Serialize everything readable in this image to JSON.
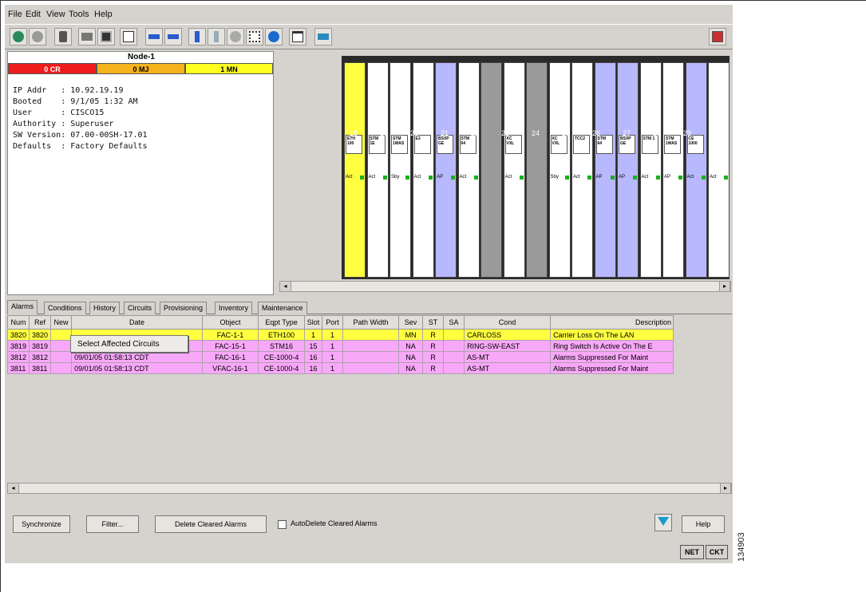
{
  "menu": [
    "File",
    "Edit",
    "View",
    "Tools",
    "Help"
  ],
  "toolbar_icons": [
    "globe-icon",
    "stop-icon",
    "lock-icon",
    "print-icon",
    "save-icon",
    "copy-icon",
    "back-arrow-icon",
    "forward-arrow-icon",
    "up-icon",
    "down-icon",
    "node-icon",
    "network-icon",
    "globe2-icon",
    "window-icon",
    "ring-icon",
    "help-book-icon"
  ],
  "node": {
    "name": "Node-1",
    "alarms": {
      "critical": "0 CR",
      "major": "0 MJ",
      "minor": "1 MN"
    },
    "info": [
      "IP Addr   : 10.92.19.19",
      "Booted    : 9/1/05 1:32 AM",
      "User      : CISCO15",
      "Authority : Superuser",
      "SW Version: 07.00-00SH-17.01",
      "Defaults  : Factory Defaults"
    ]
  },
  "slots": [
    {
      "num": "18",
      "label": "ETH 100",
      "led": "Act",
      "color": "#ffff40"
    },
    {
      "num": "19",
      "label": "STM 1E",
      "led": "Act",
      "color": "#ffffff"
    },
    {
      "num": "20",
      "label": "STM 1WAS",
      "led": "Sby",
      "color": "#ffffff"
    },
    {
      "num": "21",
      "label": "E3",
      "led": "Act",
      "color": "#ffffff"
    },
    {
      "num": "22",
      "label": "BSXP GE",
      "led": "AP",
      "color": "#b8b8ff"
    },
    {
      "num": "23",
      "label": "STM 64",
      "led": "Act",
      "color": "#ffffff"
    },
    {
      "num": "24",
      "label": "",
      "led": "",
      "color": "#9a9a9a"
    },
    {
      "num": "25",
      "label": "XC VXL",
      "led": "Act",
      "color": "#ffffff"
    },
    {
      "num": "26",
      "label": "",
      "led": "",
      "color": "#9a9a9a"
    },
    {
      "num": "27",
      "label": "XC VXL",
      "led": "Sby",
      "color": "#ffffff"
    },
    {
      "num": "28",
      "label": "TCC2",
      "led": "Act",
      "color": "#ffffff"
    },
    {
      "num": "29",
      "label": "STM 64",
      "led": "AP",
      "color": "#b8b8ff"
    },
    {
      "num": "",
      "label": "BSXP GE",
      "led": "AP",
      "color": "#b8b8ff"
    },
    {
      "num": "",
      "label": "STM 1",
      "led": "Act",
      "color": "#ffffff"
    },
    {
      "num": "",
      "label": "STM 1WAS",
      "led": "AP",
      "color": "#ffffff"
    },
    {
      "num": "",
      "label": "CE 1000",
      "led": "Act",
      "color": "#b8b8ff"
    },
    {
      "num": "",
      "label": "",
      "led": "Act",
      "color": "#ffffff"
    }
  ],
  "slot_numbers": [
    "18",
    "19",
    "20",
    "21",
    "22",
    "23",
    "24",
    "25",
    "26",
    "27",
    "28",
    "29"
  ],
  "tabs": [
    "Alarms",
    "Conditions",
    "History",
    "Circuits",
    "Provisioning",
    "Inventory",
    "Maintenance"
  ],
  "columns": [
    "Num",
    "Ref",
    "New",
    "Date",
    "Object",
    "Eqpt Type",
    "Slot",
    "Port",
    "Path Width",
    "Sev",
    "ST",
    "SA",
    "Cond",
    "Description"
  ],
  "rows": [
    {
      "num": "3820",
      "ref": "3820",
      "new": "",
      "date": "",
      "object": "FAC-1-1",
      "eqpt": "ETH100",
      "slot": "1",
      "port": "1",
      "path": "",
      "sev": "MN",
      "st": "R",
      "sa": "",
      "cond": "CARLOSS",
      "desc": "Carrier Loss On The LAN",
      "color": "yellow"
    },
    {
      "num": "3819",
      "ref": "3819",
      "new": "",
      "date": "",
      "object": "FAC-15-1",
      "eqpt": "STM16",
      "slot": "15",
      "port": "1",
      "path": "",
      "sev": "NA",
      "st": "R",
      "sa": "",
      "cond": "RING-SW-EAST",
      "desc": "Ring Switch Is Active On The E",
      "color": "pink"
    },
    {
      "num": "3812",
      "ref": "3812",
      "new": "",
      "date": "09/01/05 01:58:13 CDT",
      "object": "FAC-16-1",
      "eqpt": "CE-1000-4",
      "slot": "16",
      "port": "1",
      "path": "",
      "sev": "NA",
      "st": "R",
      "sa": "",
      "cond": "AS-MT",
      "desc": "Alarms Suppressed For Maint",
      "color": "pink"
    },
    {
      "num": "3811",
      "ref": "3811",
      "new": "",
      "date": "09/01/05 01:58:13 CDT",
      "object": "VFAC-16-1",
      "eqpt": "CE-1000-4",
      "slot": "16",
      "port": "1",
      "path": "",
      "sev": "NA",
      "st": "R",
      "sa": "",
      "cond": "AS-MT",
      "desc": "Alarms Suppressed For Maint",
      "color": "pink"
    }
  ],
  "context_menu": "Select Affected Circuits",
  "buttons": {
    "synchronize": "Synchronize",
    "filter": "Filter...",
    "delete_cleared": "Delete Cleared Alarms",
    "autodelete": "AutoDelete Cleared Alarms",
    "help": "Help"
  },
  "status": {
    "net": "NET",
    "ckt": "CKT"
  },
  "figure_id": "134903",
  "colors": {
    "critical": "#ee1c1c",
    "major": "#f4b21c",
    "minor": "#ffff20",
    "selected": "#ffff40",
    "alarm_row": "#f8a8f8"
  }
}
